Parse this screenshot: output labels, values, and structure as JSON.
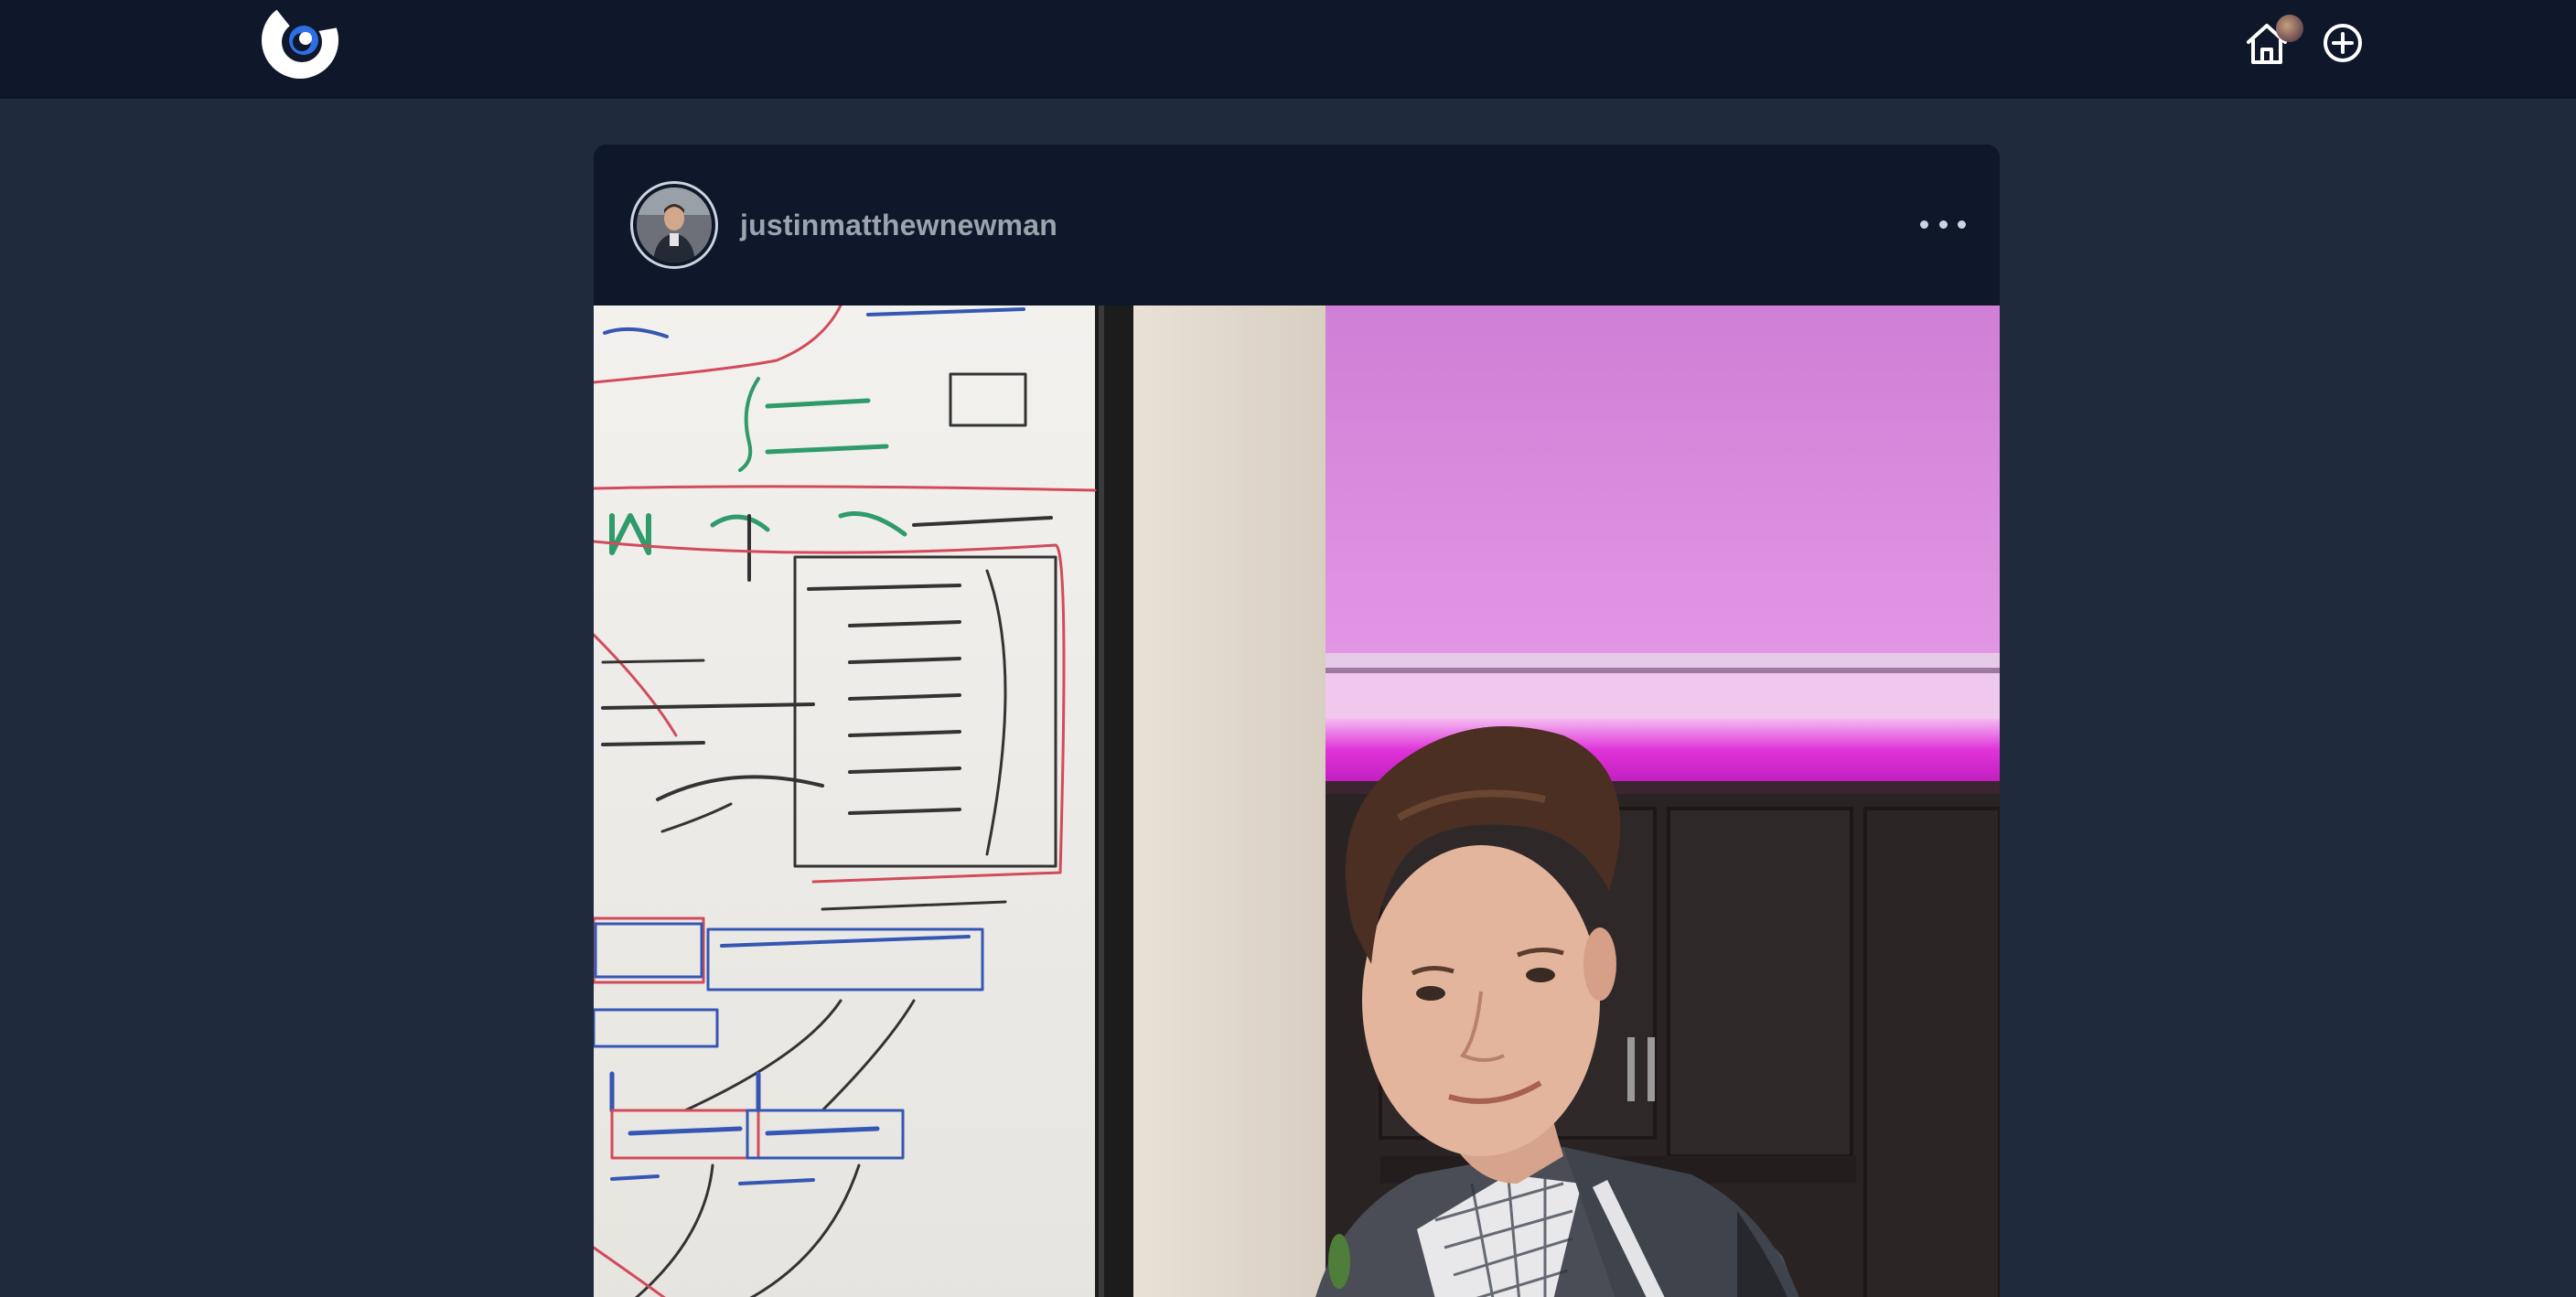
{
  "nav": {
    "logo_icon": "app-logo-icon",
    "home_icon": "home-icon",
    "add_icon": "plus-circle-icon"
  },
  "post": {
    "username": "justinmatthewnewman",
    "menu_icon": "more-horizontal-icon",
    "image_alt": "Photo of a man standing next to a whiteboard with math notes"
  },
  "colors": {
    "topbar": "#0f172a",
    "page_bg": "#1f2a3c",
    "card_bg": "#0f172a",
    "username": "#9ca3af",
    "accent": "#2563eb"
  }
}
